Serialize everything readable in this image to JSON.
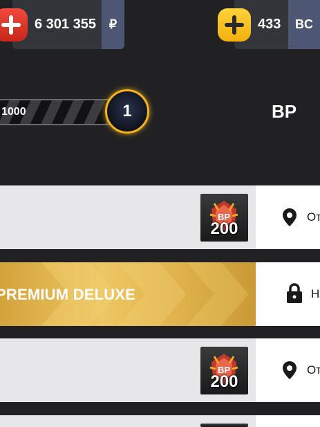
{
  "currencies": {
    "rubles": {
      "amount": "6 301 355",
      "code": "₽"
    },
    "bc": {
      "amount": "433",
      "code": "BC"
    }
  },
  "progress": {
    "label": "1000",
    "level": "1",
    "fill_fraction": 0.0
  },
  "battle_pass_title": "BP",
  "rows": [
    {
      "type": "reward",
      "reward_amount": "200",
      "reward_badge": "BP",
      "status_text": "От",
      "status_icon": "pin-icon"
    },
    {
      "type": "premium",
      "title": "PREMIUM DELUXE",
      "status_text": "Н",
      "status_icon": "lock-icon"
    },
    {
      "type": "reward",
      "reward_amount": "200",
      "reward_badge": "BP",
      "status_text": "От",
      "status_icon": "pin-icon"
    }
  ],
  "colors": {
    "background": "#212124",
    "red_plus": "#e8392c",
    "yellow_plus": "#f7c21c",
    "currency_code_bg": "#4d5673",
    "level_ring": "#f5b41c",
    "premium_gold": "#e5b957"
  }
}
